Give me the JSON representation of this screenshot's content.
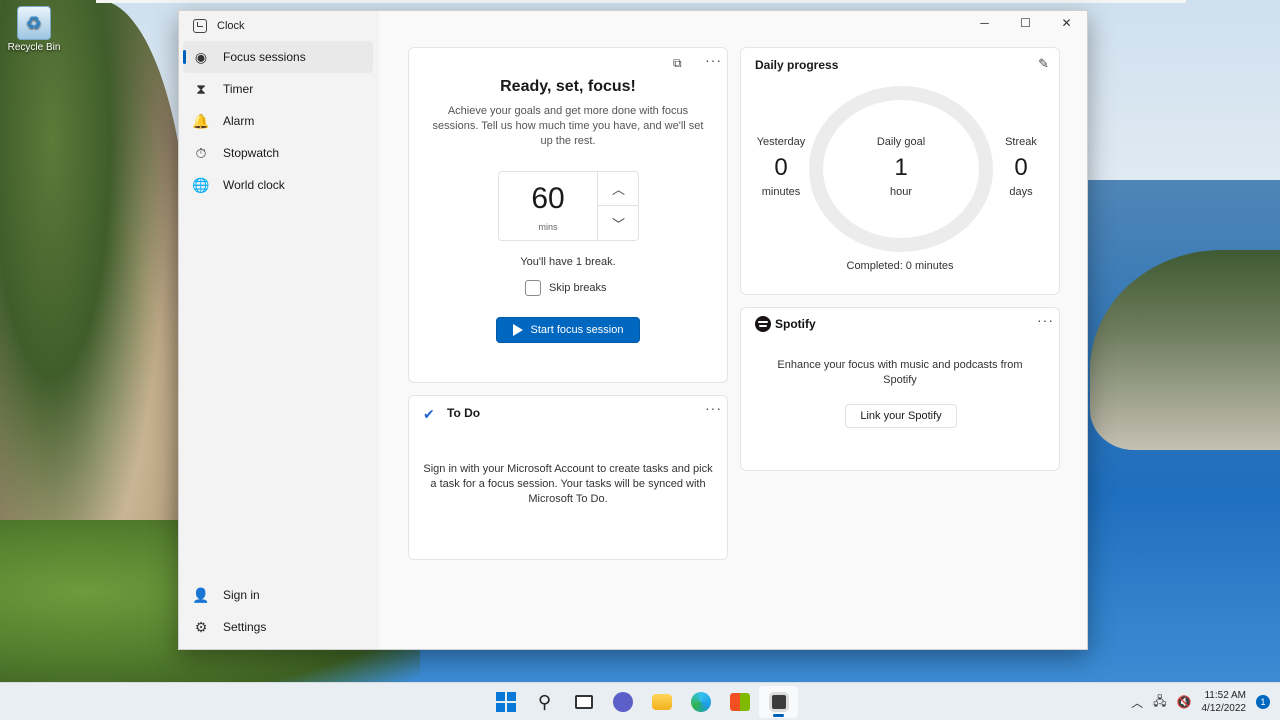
{
  "desktop": {
    "recycle_bin_label": "Recycle Bin"
  },
  "window": {
    "app_title": "Clock",
    "controls": {
      "minimize": "─",
      "maximize": "☐",
      "close": "✕"
    }
  },
  "sidebar": {
    "items": [
      {
        "label": "Focus sessions",
        "icon": "focus-icon",
        "glyph": "◉",
        "active": true
      },
      {
        "label": "Timer",
        "icon": "hourglass-icon",
        "glyph": "⧗"
      },
      {
        "label": "Alarm",
        "icon": "alarm-icon",
        "glyph": "🔔"
      },
      {
        "label": "Stopwatch",
        "icon": "stopwatch-icon",
        "glyph": "⏱"
      },
      {
        "label": "World clock",
        "icon": "globe-icon",
        "glyph": "🌐"
      }
    ],
    "bottom": [
      {
        "label": "Sign in",
        "icon": "person-icon",
        "glyph": "👤"
      },
      {
        "label": "Settings",
        "icon": "gear-icon",
        "glyph": "⚙"
      }
    ]
  },
  "focus": {
    "heading": "Ready, set, focus!",
    "description": "Achieve your goals and get more done with focus sessions. Tell us how much time you have, and we'll set up the rest.",
    "minutes_value": "60",
    "minutes_unit": "mins",
    "break_text": "You'll have 1 break.",
    "skip_breaks_label": "Skip breaks",
    "start_button_label": "Start focus session",
    "menu": "···"
  },
  "todo": {
    "title": "To Do",
    "message": "Sign in with your Microsoft Account to create tasks and pick a task for a focus session. Your tasks will be synced with Microsoft To Do.",
    "menu": "···"
  },
  "daily_progress": {
    "title": "Daily progress",
    "yesterday": {
      "label": "Yesterday",
      "value": "0",
      "unit": "minutes"
    },
    "daily_goal": {
      "label": "Daily goal",
      "value": "1",
      "unit": "hour"
    },
    "streak": {
      "label": "Streak",
      "value": "0",
      "unit": "days"
    },
    "completed_text": "Completed: 0 minutes"
  },
  "spotify": {
    "logo_text": "Spotify",
    "message": "Enhance your focus with music and podcasts from Spotify",
    "link_button_label": "Link your Spotify",
    "menu": "···"
  },
  "taskbar": {
    "time": "11:52 AM",
    "date": "4/12/2022",
    "notification_count": "1",
    "colors": {
      "accent": "#0067c0"
    }
  }
}
